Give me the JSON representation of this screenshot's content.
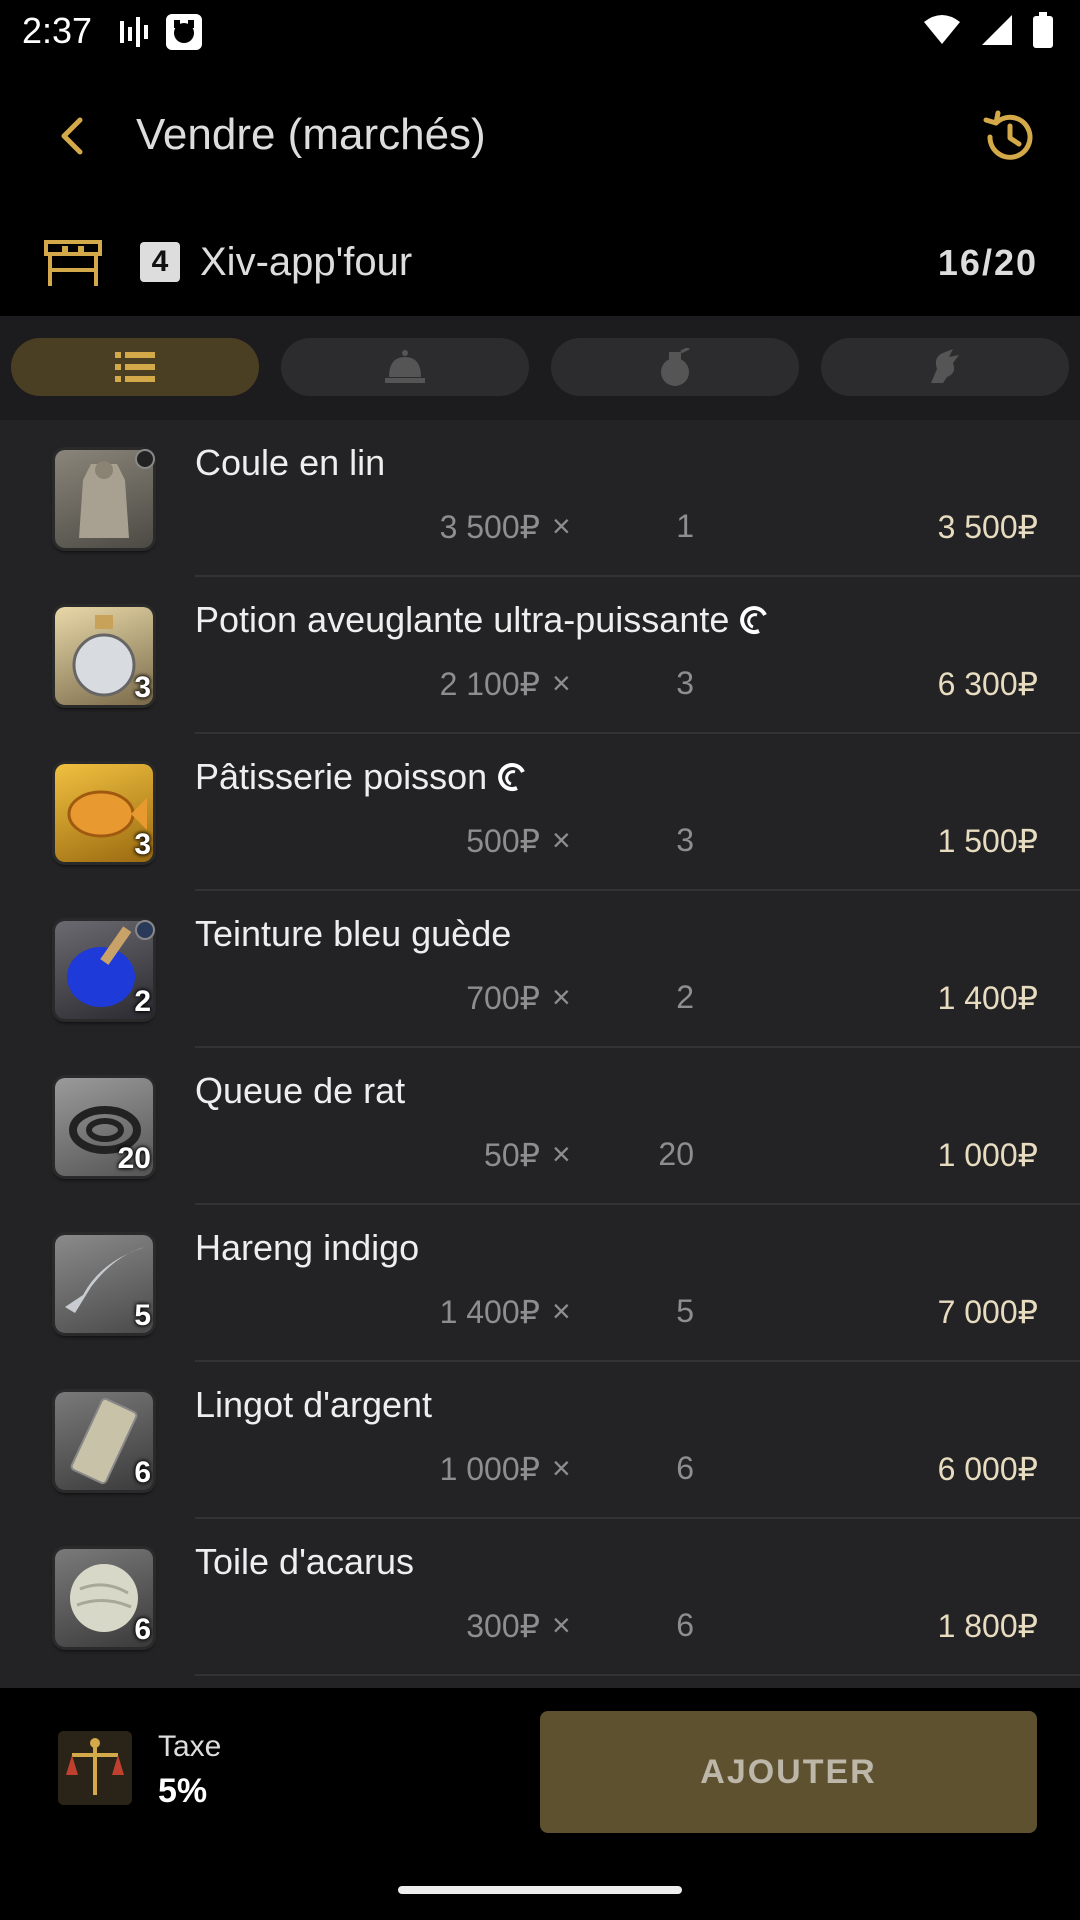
{
  "status_bar": {
    "time": "2:37"
  },
  "app_bar": {
    "title": "Vendre (marchés)"
  },
  "retainer": {
    "number": "4",
    "name": "Xiv-app'four",
    "count": "16/20"
  },
  "tabs": [
    {
      "icon": "list-icon",
      "active": true
    },
    {
      "icon": "bell-icon",
      "active": false
    },
    {
      "icon": "pot-icon",
      "active": false
    },
    {
      "icon": "chocobo-icon",
      "active": false
    }
  ],
  "items": [
    {
      "name": "Coule en lin",
      "price": "3 500₽",
      "times": "×",
      "qty": "1",
      "total": "3 500₽",
      "badge": "",
      "hq": false
    },
    {
      "name": "Potion aveuglante ultra-puissante",
      "price": "2 100₽",
      "times": "×",
      "qty": "3",
      "total": "6 300₽",
      "badge": "3",
      "hq": true
    },
    {
      "name": "Pâtisserie poisson",
      "price": "500₽",
      "times": "×",
      "qty": "3",
      "total": "1 500₽",
      "badge": "3",
      "hq": true
    },
    {
      "name": "Teinture bleu guède",
      "price": "700₽",
      "times": "×",
      "qty": "2",
      "total": "1 400₽",
      "badge": "2",
      "hq": false
    },
    {
      "name": "Queue de rat",
      "price": "50₽",
      "times": "×",
      "qty": "20",
      "total": "1 000₽",
      "badge": "20",
      "hq": false
    },
    {
      "name": "Hareng indigo",
      "price": "1 400₽",
      "times": "×",
      "qty": "5",
      "total": "7 000₽",
      "badge": "5",
      "hq": false
    },
    {
      "name": "Lingot d'argent",
      "price": "1 000₽",
      "times": "×",
      "qty": "6",
      "total": "6 000₽",
      "badge": "6",
      "hq": false
    },
    {
      "name": "Toile d'acarus",
      "price": "300₽",
      "times": "×",
      "qty": "6",
      "total": "1 800₽",
      "badge": "6",
      "hq": false
    }
  ],
  "footer": {
    "tax_label": "Taxe",
    "tax_value": "5%",
    "add_button": "AJOUTER"
  },
  "colors": {
    "accent": "#d4a94a",
    "add_button_bg": "#5e5130",
    "active_tab": "#4a3f22"
  }
}
